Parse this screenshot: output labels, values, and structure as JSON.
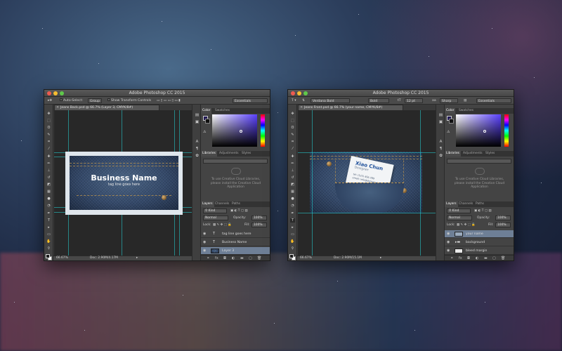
{
  "windows": [
    {
      "title": "Adobe Photoshop CC 2015",
      "options": {
        "auto_select_label": "Auto-Select:",
        "auto_select_value": "Group",
        "show_transform_label": "Show Transform Controls",
        "workspace": "Essentials"
      },
      "doc_tab": "Jeans Back.psd @ 66.7% (Layer 3, CMYK/8#)",
      "canvas": {
        "business_name": "Business Name",
        "tag_line": "tag line goes here"
      },
      "status": {
        "zoom": "66.67%",
        "doc": "Doc: 2.90M/4.17M"
      },
      "panels": {
        "color_tabs": [
          "Color",
          "Swatches"
        ],
        "library_tabs": [
          "Libraries",
          "Adjustments",
          "Styles"
        ],
        "library_message": [
          "To use Creative Cloud Libraries,",
          "please install the Creative Cloud",
          "Application"
        ],
        "layer_tabs": [
          "Layers",
          "Channels",
          "Paths"
        ],
        "kind": "Kind",
        "blend_mode": "Normal",
        "opacity_label": "Opacity:",
        "opacity_value": "100%",
        "lock_label": "Lock:",
        "fill_label": "Fill:",
        "fill_value": "100%",
        "layers": [
          {
            "name": "tag line goes here",
            "type": "text",
            "selected": false
          },
          {
            "name": "Business Name",
            "type": "text",
            "selected": false
          },
          {
            "name": "Layer 3",
            "type": "image",
            "selected": true
          }
        ]
      }
    },
    {
      "title": "Adobe Photoshop CC 2015",
      "options": {
        "font_family": "Verdana Bold",
        "font_style": "Bold",
        "font_size": "12 pt",
        "antialias": "Sharp",
        "workspace": "Essentials"
      },
      "doc_tab": "Jeans Front.psd @ 66.7% (your name, CMYK/8#)",
      "canvas": {
        "card_name": "Xiao Chun",
        "card_title": "Designer",
        "card_line1": "tel: (123) 456-789",
        "card_line2": "email: info@domain.com"
      },
      "status": {
        "zoom": "66.67%",
        "doc": "Doc: 2.90M/15.1M"
      },
      "panels": {
        "color_tabs": [
          "Color",
          "Swatches"
        ],
        "library_tabs": [
          "Libraries",
          "Adjustments",
          "Styles"
        ],
        "library_message": [
          "To use Creative Cloud Libraries,",
          "please install the Creative Cloud",
          "Application"
        ],
        "layer_tabs": [
          "Layers",
          "Channels",
          "Paths"
        ],
        "kind": "Kind",
        "blend_mode": "Normal",
        "opacity_label": "Opacity:",
        "opacity_value": "100%",
        "lock_label": "Lock:",
        "fill_label": "Fill:",
        "fill_value": "100%",
        "layers": [
          {
            "name": "your name",
            "type": "image",
            "selected": true
          },
          {
            "name": "background",
            "type": "folder",
            "selected": false
          },
          {
            "name": "bleed margin",
            "type": "image",
            "selected": false
          }
        ]
      }
    }
  ],
  "colors": {
    "guide": "#27d3d6",
    "selection": "#6e7f96",
    "panel": "#444444",
    "card_name": "#1e4f9a"
  }
}
